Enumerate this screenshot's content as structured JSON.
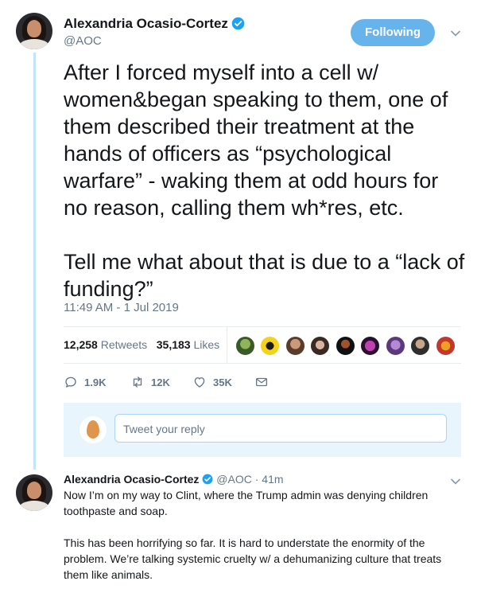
{
  "author": {
    "name": "Alexandria Ocasio-Cortez",
    "handle": "@AOC"
  },
  "follow_button": "Following",
  "tweet": {
    "text": "After I forced myself into a cell w/ women&began speaking to them, one of them described their treatment at the hands of officers as “psychological warfare” - waking them at odd hours for no reason, calling them wh*res, etc.\n\nTell me what about that is due to a “lack of funding?”",
    "timestamp": "11:49 AM - 1 Jul 2019"
  },
  "stats": {
    "retweets_count": "12,258",
    "retweets_label": "Retweets",
    "likes_count": "35,183",
    "likes_label": "Likes"
  },
  "actions": {
    "reply_count": "1.9K",
    "retweet_count": "12K",
    "like_count": "35K"
  },
  "reply_box": {
    "placeholder": "Tweet your reply"
  },
  "reply_tweet": {
    "name": "Alexandria Ocasio-Cortez",
    "handle": "@AOC",
    "time": "· 41m",
    "text": "Now I’m on my way to Clint, where the Trump admin was denying children toothpaste and soap.\n\nThis has been horrifying so far. It is hard to understate the enormity of the problem. We’re talking systemic cruelty w/ a dehumanizing culture that treats them like animals."
  },
  "colors": {
    "accent": "#1da1f2",
    "following_button": "#66b4eb",
    "thread_line": "#c4e4f7"
  }
}
